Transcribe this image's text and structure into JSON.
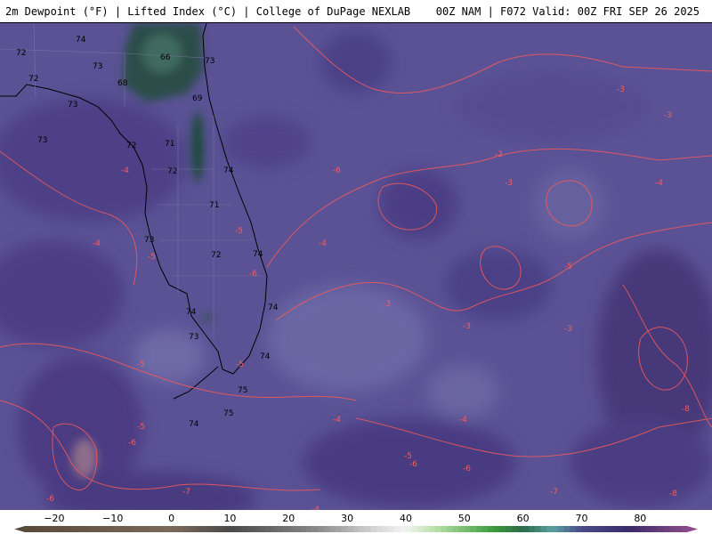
{
  "header": {
    "left_title": "2m Dewpoint (°F) | Lifted Index (°C) | College of DuPage NEXLAB",
    "right_title": "00Z NAM | F072 Valid: 00Z FRI SEP 26 2025"
  },
  "colorbar": {
    "tick_labels": [
      "−20",
      "−10",
      "0",
      "10",
      "20",
      "30",
      "40",
      "50",
      "60",
      "70",
      "80"
    ],
    "min": -25,
    "max": 88
  },
  "map": {
    "dewpoint_labels": [
      "74",
      "72",
      "73",
      "72",
      "66",
      "73",
      "73",
      "68",
      "69",
      "73",
      "72",
      "71",
      "72",
      "74",
      "71",
      "74",
      "73",
      "72",
      "74",
      "74",
      "73",
      "74",
      "75",
      "74",
      "75"
    ],
    "lifted_index_labels": [
      "-3",
      "-3",
      "-2",
      "-4",
      "-6",
      "-3",
      "-4",
      "-5",
      "-4",
      "-4",
      "-5",
      "-3",
      "-5",
      "-3",
      "-3",
      "-6",
      "-5",
      "-5",
      "-5",
      "-6",
      "-4",
      "-5",
      "-4",
      "-6",
      "-7",
      "-8",
      "-7",
      "-6",
      "-8",
      "-5",
      "-4",
      "-6"
    ]
  },
  "colors": {
    "background": "#5a4f93",
    "li_contour": "#f25a5a",
    "dewpoint_70s_dark": "#4d3f85",
    "dewpoint_60s_green": "#1f4a3a",
    "coast": "#000000"
  }
}
